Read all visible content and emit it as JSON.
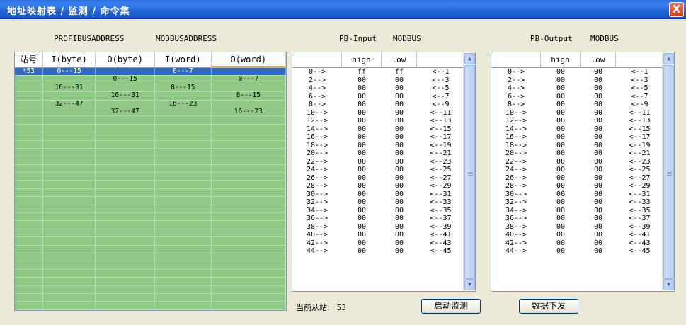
{
  "window": {
    "title": "地址映射表 / 监测 / 命令集",
    "close_glyph": "X"
  },
  "headers": {
    "profibus": "PROFIBUSADDRESS",
    "modbus": "MODBUSADDRESS",
    "pb_input": "PB-Input",
    "modbus_in": "MODBUS",
    "pb_output": "PB-Output",
    "modbus_out": "MODBUS"
  },
  "map_table": {
    "columns": [
      "站号",
      "I(byte)",
      "O(byte)",
      "I(word)",
      "O(word)"
    ],
    "rows": [
      [
        "*53",
        "0---15",
        "",
        "0---7",
        ""
      ],
      [
        "",
        "",
        "0---15",
        "",
        "0---7"
      ],
      [
        "",
        "16---31",
        "",
        "8---15",
        ""
      ],
      [
        "",
        "",
        "16---31",
        "",
        "8---15"
      ],
      [
        "",
        "32---47",
        "",
        "16---23",
        ""
      ],
      [
        "",
        "",
        "32---47",
        "",
        "16---23"
      ]
    ]
  },
  "input_table": {
    "columns": [
      "",
      "high",
      "low",
      ""
    ],
    "rows": [
      [
        "0-->",
        "ff",
        "ff",
        "<--1"
      ],
      [
        "2-->",
        "00",
        "00",
        "<--3"
      ],
      [
        "4-->",
        "00",
        "00",
        "<--5"
      ],
      [
        "6-->",
        "00",
        "00",
        "<--7"
      ],
      [
        "8-->",
        "00",
        "00",
        "<--9"
      ],
      [
        "10-->",
        "00",
        "00",
        "<--11"
      ],
      [
        "12-->",
        "00",
        "00",
        "<--13"
      ],
      [
        "14-->",
        "00",
        "00",
        "<--15"
      ],
      [
        "16-->",
        "00",
        "00",
        "<--17"
      ],
      [
        "18-->",
        "00",
        "00",
        "<--19"
      ],
      [
        "20-->",
        "00",
        "00",
        "<--21"
      ],
      [
        "22-->",
        "00",
        "00",
        "<--23"
      ],
      [
        "24-->",
        "00",
        "00",
        "<--25"
      ],
      [
        "26-->",
        "00",
        "00",
        "<--27"
      ],
      [
        "28-->",
        "00",
        "00",
        "<--29"
      ],
      [
        "30-->",
        "00",
        "00",
        "<--31"
      ],
      [
        "32-->",
        "00",
        "00",
        "<--33"
      ],
      [
        "34-->",
        "00",
        "00",
        "<--35"
      ],
      [
        "36-->",
        "00",
        "00",
        "<--37"
      ],
      [
        "38-->",
        "00",
        "00",
        "<--39"
      ],
      [
        "40-->",
        "00",
        "00",
        "<--41"
      ],
      [
        "42-->",
        "00",
        "00",
        "<--43"
      ],
      [
        "44-->",
        "00",
        "00",
        "<--45"
      ]
    ]
  },
  "output_table": {
    "columns": [
      "",
      "high",
      "low",
      ""
    ],
    "rows": [
      [
        "0-->",
        "00",
        "00",
        "<--1"
      ],
      [
        "2-->",
        "00",
        "00",
        "<--3"
      ],
      [
        "4-->",
        "00",
        "00",
        "<--5"
      ],
      [
        "6-->",
        "00",
        "00",
        "<--7"
      ],
      [
        "8-->",
        "00",
        "00",
        "<--9"
      ],
      [
        "10-->",
        "00",
        "00",
        "<--11"
      ],
      [
        "12-->",
        "00",
        "00",
        "<--13"
      ],
      [
        "14-->",
        "00",
        "00",
        "<--15"
      ],
      [
        "16-->",
        "00",
        "00",
        "<--17"
      ],
      [
        "18-->",
        "00",
        "00",
        "<--19"
      ],
      [
        "20-->",
        "00",
        "00",
        "<--21"
      ],
      [
        "22-->",
        "00",
        "00",
        "<--23"
      ],
      [
        "24-->",
        "00",
        "00",
        "<--25"
      ],
      [
        "26-->",
        "00",
        "00",
        "<--27"
      ],
      [
        "28-->",
        "00",
        "00",
        "<--29"
      ],
      [
        "30-->",
        "00",
        "00",
        "<--31"
      ],
      [
        "32-->",
        "00",
        "00",
        "<--33"
      ],
      [
        "34-->",
        "00",
        "00",
        "<--35"
      ],
      [
        "36-->",
        "00",
        "00",
        "<--37"
      ],
      [
        "38-->",
        "00",
        "00",
        "<--39"
      ],
      [
        "40-->",
        "00",
        "00",
        "<--41"
      ],
      [
        "42-->",
        "00",
        "00",
        "<--43"
      ],
      [
        "44-->",
        "00",
        "00",
        "<--45"
      ]
    ]
  },
  "status": {
    "label": "当前从站:",
    "value": "53"
  },
  "buttons": {
    "start_monitor": "启动监测",
    "send_data": "数据下发"
  },
  "icons": {
    "scroll_up": "scroll-up-arrow-icon",
    "scroll_down": "scroll-down-arrow-icon"
  },
  "colors": {
    "titlebar": "#2a66d8",
    "map_bg": "#90c986",
    "selection": "#316ac5"
  }
}
